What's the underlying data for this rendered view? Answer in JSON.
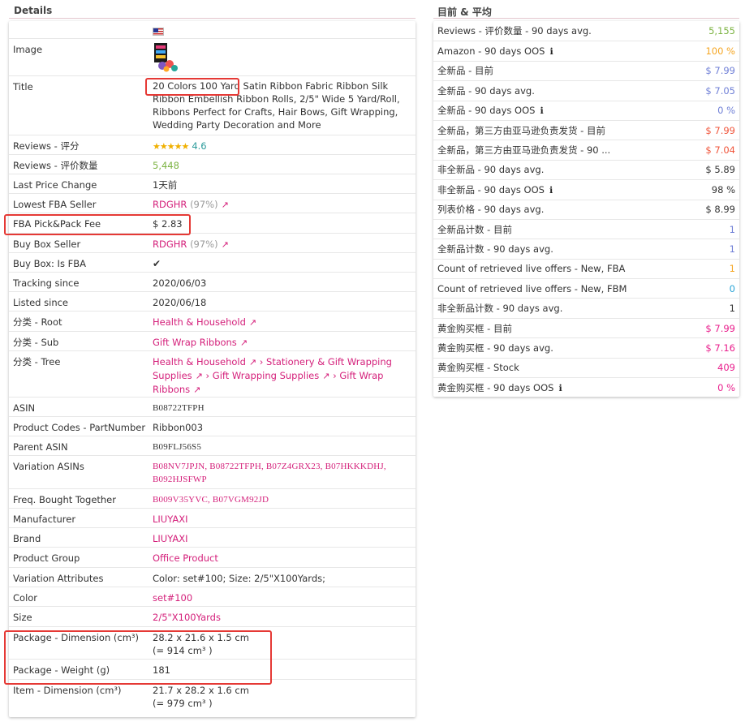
{
  "left": {
    "title": "Details",
    "rows": {
      "image": "Image",
      "title_lbl": "Title",
      "title_val": "20 Colors 100 Yard Satin Ribbon Fabric Ribbon Silk Ribbon Embellish Ribbon Rolls, 2/5\" Wide 5 Yard/Roll, Ribbons Perfect for Crafts, Hair Bows, Gift Wrapping, Wedding Party Decoration and More",
      "reviews_lbl": "Reviews - 评分",
      "reviews_stars": "★★★★★",
      "reviews_val": "4.6",
      "rcount_lbl": "Reviews - 评价数量",
      "rcount_val": "5,448",
      "lpc_lbl": "Last Price Change",
      "lpc_val": "1天前",
      "lfba_lbl": "Lowest FBA Seller",
      "lfba_val": "RDGHR",
      "lfba_pct": "(97%)",
      "fee_lbl": "FBA Pick&Pack Fee",
      "fee_val": "$ 2.83",
      "bbs_lbl": "Buy Box Seller",
      "bbs_val": "RDGHR",
      "bbs_pct": "(97%)",
      "bbfba_lbl": "Buy Box: Is FBA",
      "bbfba_val": "✔",
      "track_lbl": "Tracking since",
      "track_val": "2020/06/03",
      "listed_lbl": "Listed since",
      "listed_val": "2020/06/18",
      "root_lbl": "分类 - Root",
      "root_val": "Health & Household",
      "sub_lbl": "分类 - Sub",
      "sub_val": "Gift Wrap Ribbons",
      "tree_lbl": "分类 - Tree",
      "tree_1": "Health & Household",
      "tree_2": "Stationery & Gift Wrapping Supplies",
      "tree_3": "Gift Wrapping Supplies",
      "tree_4": "Gift Wrap Ribbons",
      "sep": "›",
      "asin_lbl": "ASIN",
      "asin_val": "B08722TFPH",
      "pc_lbl": "Product Codes - PartNumber",
      "pc_val": "Ribbon003",
      "pasin_lbl": "Parent ASIN",
      "pasin_val": "B09FLJ56S5",
      "vasin_lbl": "Variation ASINs",
      "vasin_val": "B08NV7JPJN, B08722TFPH, B07Z4GRX23, B07HKKKDHJ, B092HJSFWP",
      "fbt_lbl": "Freq. Bought Together",
      "fbt_val": "B009V35YVC, B07VGM92JD",
      "mfr_lbl": "Manufacturer",
      "mfr_val": "LIUYAXI",
      "brand_lbl": "Brand",
      "brand_val": "LIUYAXI",
      "pg_lbl": "Product Group",
      "pg_val": "Office Product",
      "va_lbl": "Variation Attributes",
      "va_val": "Color: set#100; Size: 2/5\"X100Yards;",
      "color_lbl": "Color",
      "color_val": "set#100",
      "size_lbl": "Size",
      "size_val": "2/5\"X100Yards",
      "pdim_lbl": "Package - Dimension (cm³)",
      "pdim_val1": "28.2 x 21.6 x 1.5 cm",
      "pdim_val2": "(= 914 cm³ )",
      "pw_lbl": "Package - Weight (g)",
      "pw_val": "181",
      "idim_lbl": "Item - Dimension (cm³)",
      "idim_val1": "21.7 x 28.2 x 1.6 cm",
      "idim_val2": "(= 979 cm³ )"
    }
  },
  "right": {
    "title": "目前 & 平均",
    "rows": [
      {
        "label": "Reviews - 评价数量 - 90 days avg.",
        "value": "5,155",
        "color": "#7cb342",
        "info": false
      },
      {
        "label": "Amazon - 90 days OOS",
        "value": "100 %",
        "color": "#f5a623",
        "info": true
      },
      {
        "label": "全新品 - 目前",
        "value": "$ 7.99",
        "color": "#6f7fd6",
        "info": false
      },
      {
        "label": "全新品 - 90 days avg.",
        "value": "$ 7.05",
        "color": "#6f7fd6",
        "info": false
      },
      {
        "label": "全新品 - 90 days OOS",
        "value": "0 %",
        "color": "#6f7fd6",
        "info": true
      },
      {
        "label": "全新品，第三方由亚马逊负责发货 - 目前",
        "value": "$ 7.99",
        "color": "#f0553b",
        "info": false
      },
      {
        "label": "全新品，第三方由亚马逊负责发货 - 90 ...",
        "value": "$ 7.04",
        "color": "#f0553b",
        "info": false
      },
      {
        "label": "非全新品 - 90 days avg.",
        "value": "$ 5.89",
        "color": "#333333",
        "info": false
      },
      {
        "label": "非全新品 - 90 days OOS",
        "value": "98 %",
        "color": "#333333",
        "info": true
      },
      {
        "label": "列表价格 - 90 days avg.",
        "value": "$ 8.99",
        "color": "#333333",
        "info": false
      },
      {
        "label": "全新品计数 - 目前",
        "value": "1",
        "color": "#6f7fd6",
        "info": false
      },
      {
        "label": "全新品计数 - 90 days avg.",
        "value": "1",
        "color": "#6f7fd6",
        "info": false
      },
      {
        "label": "Count of retrieved live offers - New, FBA",
        "value": "1",
        "color": "#f5a623",
        "info": false
      },
      {
        "label": "Count of retrieved live offers - New, FBM",
        "value": "0",
        "color": "#29a3d6",
        "info": false
      },
      {
        "label": "非全新品计数 - 90 days avg.",
        "value": "1",
        "color": "#333333",
        "info": false
      },
      {
        "label": "黄金购买框 - 目前",
        "value": "$ 7.99",
        "color": "#e91e8c",
        "info": false
      },
      {
        "label": "黄金购买框 - 90 days avg.",
        "value": "$ 7.16",
        "color": "#e91e8c",
        "info": false
      },
      {
        "label": "黄金购买框 - Stock",
        "value": "409",
        "color": "#e91e8c",
        "info": false
      },
      {
        "label": "黄金购买框 - 90 days OOS",
        "value": "0 %",
        "color": "#e91e8c",
        "info": true
      }
    ]
  }
}
